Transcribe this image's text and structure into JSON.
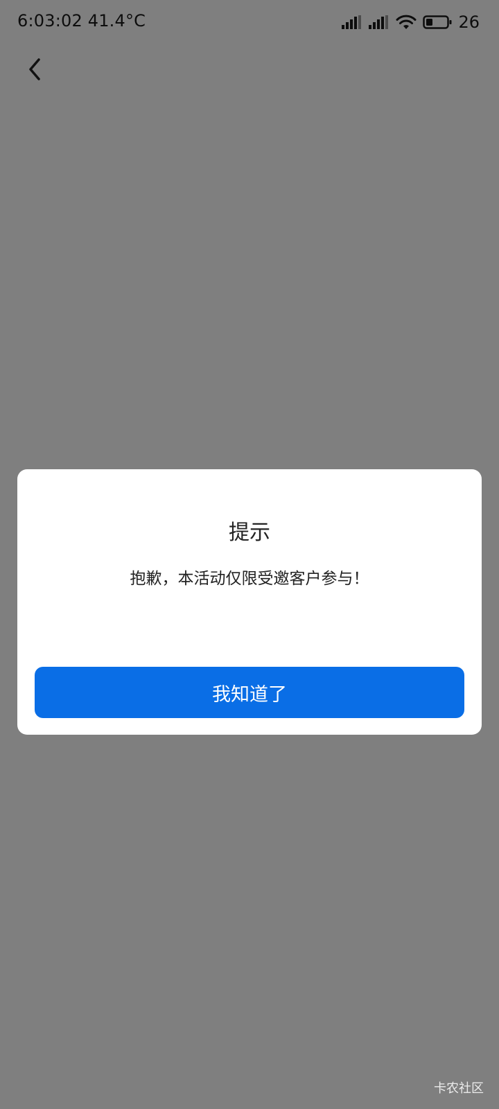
{
  "status_bar": {
    "time_temp": "6:03:02 41.4°C",
    "battery_level": "26",
    "icons": [
      "signal-bars-icon",
      "signal-bars-icon",
      "wifi-icon",
      "battery-icon"
    ]
  },
  "header": {
    "back_icon": "chevron-left-icon"
  },
  "dialog": {
    "title": "提示",
    "message": "抱歉，本活动仅限受邀客户参与！",
    "confirm_label": "我知道了"
  },
  "watermark": "卡农社区",
  "colors": {
    "overlay": "#808080",
    "button": "#0a6ee6",
    "dialog_bg": "#ffffff"
  }
}
